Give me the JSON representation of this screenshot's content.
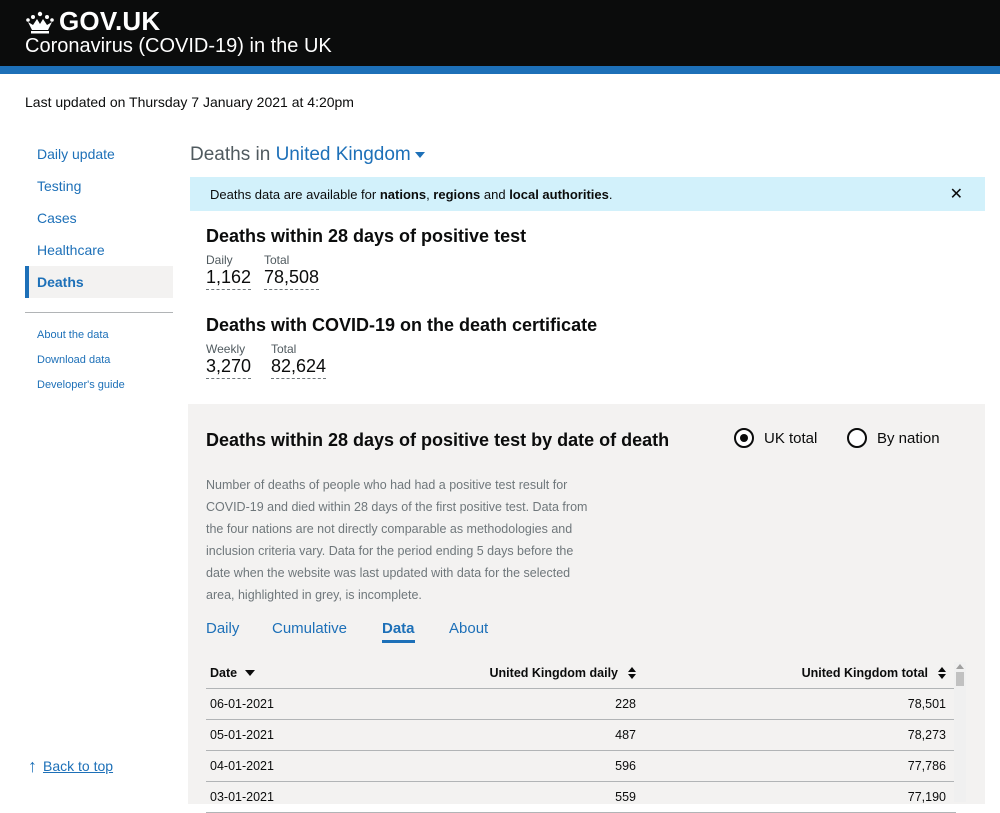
{
  "header": {
    "logo_text": "GOV.UK",
    "service_name": "Coronavirus (COVID-19) in the UK",
    "logo_icon": "crown-icon",
    "colors": {
      "header_bg": "#0b0c0c",
      "stripe": "#1d70b8"
    }
  },
  "last_updated": "Last updated on Thursday 7 January 2021 at 4:20pm",
  "sidebar": {
    "items": [
      {
        "label": "Daily update"
      },
      {
        "label": "Testing"
      },
      {
        "label": "Cases"
      },
      {
        "label": "Healthcare"
      },
      {
        "label": "Deaths",
        "active": true
      }
    ],
    "secondary": [
      {
        "label": "About the data"
      },
      {
        "label": "Download data"
      },
      {
        "label": "Developer's guide"
      }
    ],
    "back_to_top": "Back to top",
    "back_to_top_icon": "arrow-up-icon"
  },
  "page": {
    "heading_prefix": "Deaths in",
    "location": "United Kingdom"
  },
  "notice": {
    "text_1": "Deaths data are available for ",
    "bold_1": "nations",
    "text_2": ", ",
    "bold_2": "regions",
    "text_3": " and ",
    "bold_3": "local authorities",
    "text_4": ".",
    "close": "✕"
  },
  "headlines": [
    {
      "title": "Deaths within 28 days of positive test",
      "metrics": [
        {
          "label": "Daily",
          "value": "1,162"
        },
        {
          "label": "Total",
          "value": "78,508"
        }
      ]
    },
    {
      "title": "Deaths with COVID-19 on the death certificate",
      "metrics": [
        {
          "label": "Weekly",
          "value": "3,270"
        },
        {
          "label": "Total",
          "value": "82,624"
        }
      ]
    }
  ],
  "card": {
    "title": "Deaths within 28 days of positive test by date of death",
    "radios": [
      {
        "label": "UK total",
        "selected": true
      },
      {
        "label": "By nation",
        "selected": false
      }
    ],
    "description": "Number of deaths of people who had had a positive test result for COVID-19 and died within 28 days of the first positive test. Data from the four nations are not directly comparable as methodologies and inclusion criteria vary. Data for the period ending 5 days before the date when the website was last updated with data for the selected area, highlighted in grey, is incomplete.",
    "tabs": [
      {
        "label": "Daily"
      },
      {
        "label": "Cumulative"
      },
      {
        "label": "Data",
        "active": true
      },
      {
        "label": "About"
      }
    ],
    "table": {
      "columns": [
        "Date",
        "United Kingdom daily",
        "United Kingdom total"
      ],
      "rows": [
        [
          "06-01-2021",
          "228",
          "78,501"
        ],
        [
          "05-01-2021",
          "487",
          "78,273"
        ],
        [
          "04-01-2021",
          "596",
          "77,786"
        ],
        [
          "03-01-2021",
          "559",
          "77,190"
        ]
      ]
    }
  }
}
